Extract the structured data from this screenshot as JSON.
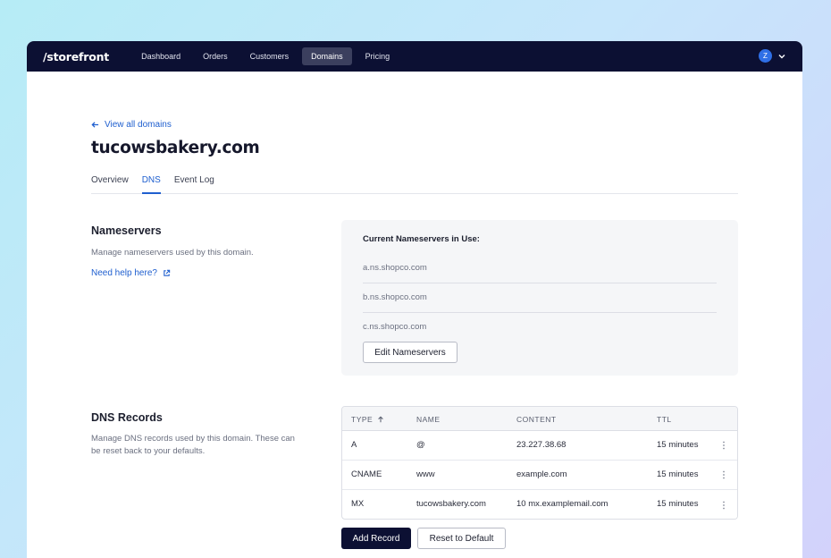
{
  "nav": {
    "logo": "/storefront",
    "items": [
      {
        "label": "Dashboard",
        "active": false
      },
      {
        "label": "Orders",
        "active": false
      },
      {
        "label": "Customers",
        "active": false
      },
      {
        "label": "Domains",
        "active": true
      },
      {
        "label": "Pricing",
        "active": false
      }
    ],
    "user_initial": "Z",
    "icons": {
      "user_menu": "chevron-down-icon"
    }
  },
  "page": {
    "back_link": "View all domains",
    "title": "tucowsbakery.com",
    "tabs": [
      {
        "label": "Overview",
        "active": false
      },
      {
        "label": "DNS",
        "active": true
      },
      {
        "label": "Event Log",
        "active": false
      }
    ]
  },
  "nameservers": {
    "title": "Nameservers",
    "description": "Manage nameservers used by this domain.",
    "help_link": "Need help here?",
    "card_heading": "Current Nameservers in Use:",
    "servers": [
      "a.ns.shopco.com",
      "b.ns.shopco.com",
      "c.ns.shopco.com"
    ],
    "edit_button": "Edit Nameservers"
  },
  "dns_records": {
    "title": "DNS Records",
    "description": "Manage DNS records used by this domain. These can be reset back to your defaults.",
    "columns": [
      "TYPE",
      "NAME",
      "CONTENT",
      "TTL"
    ],
    "rows": [
      {
        "type": "A",
        "name": "@",
        "content": "23.227.38.68",
        "ttl": "15 minutes"
      },
      {
        "type": "CNAME",
        "name": "www",
        "content": "example.com",
        "ttl": "15 minutes"
      },
      {
        "type": "MX",
        "name": "tucowsbakery.com",
        "content": "10 mx.examplemail.com",
        "ttl": "15 minutes"
      }
    ],
    "add_button": "Add Record",
    "reset_button": "Reset to Default"
  },
  "colors": {
    "nav_bg": "#0c1033",
    "accent": "#1f5fcf",
    "primary_button": "#0c1033"
  }
}
